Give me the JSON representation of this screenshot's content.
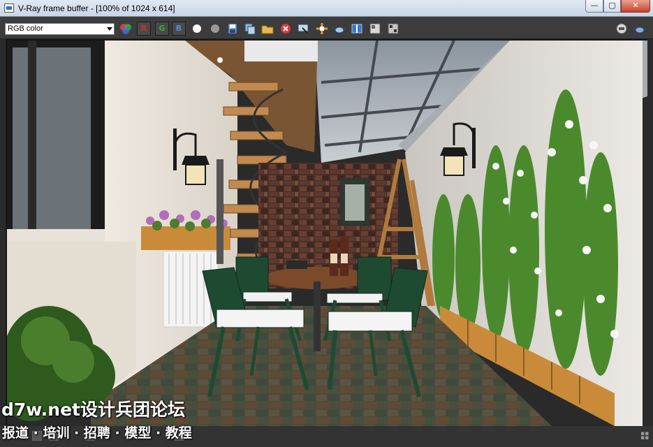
{
  "window": {
    "title": "V-Ray frame buffer - [100% of 1024 x 614]",
    "minimize_glyph": "—",
    "maximize_glyph": "▢",
    "close_glyph": "✕"
  },
  "toolbar": {
    "channel": "RGB color",
    "red_label": "R",
    "green_label": "G",
    "blue_label": "B",
    "icons": [
      "color-wheel-icon",
      "white-circle-icon",
      "gray-circle-icon",
      "save-icon",
      "copy-icon",
      "folder-icon",
      "clear-icon",
      "track-mouse-icon",
      "region-render-icon",
      "teapot-icon",
      "compare-icon",
      "lut-icon",
      "pixel-info-icon",
      "stop-icon",
      "render-teapot-icon"
    ]
  },
  "colors": {
    "titlebar": "#d4dfec",
    "toolbar": "#3c3c3c",
    "close": "#c7402a",
    "red_channel": "#d03030",
    "green_channel": "#3aaa3a",
    "blue_channel": "#4a78d0"
  },
  "watermark": {
    "line1": "d7w.net设计兵团论坛",
    "line2": "报道 · 培训 · 招聘 · 模型 · 教程"
  }
}
